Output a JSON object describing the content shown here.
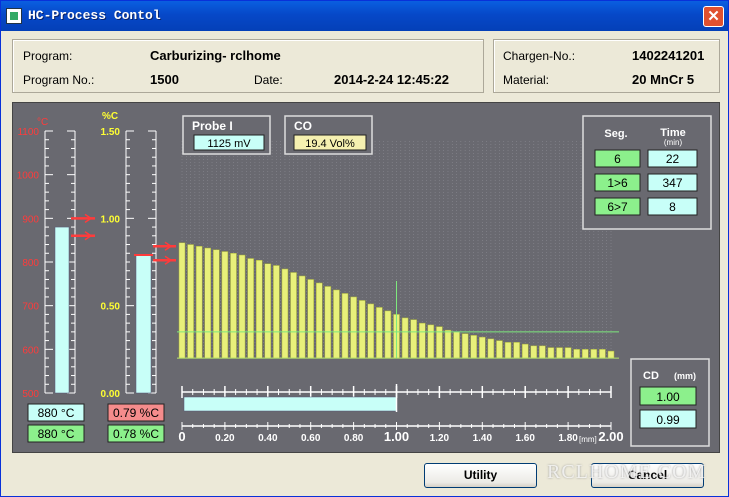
{
  "window": {
    "title": "HC-Process Contol",
    "close_glyph": "✕"
  },
  "program_info": {
    "program_label": "Program:",
    "program_value": "Carburizing- rclhome",
    "program_no_label": "Program No.:",
    "program_no_value": "1500",
    "date_label": "Date:",
    "date_value": "2014-2-24 12:45:22"
  },
  "charge_info": {
    "chargen_label": "Chargen-No.:",
    "chargen_value": "1402241201",
    "material_label": "Material:",
    "material_value": "20 MnCr 5"
  },
  "temp_gauge": {
    "unit": "°C",
    "ticks": [
      "1100",
      "1000",
      "900",
      "800",
      "700",
      "600",
      "500"
    ],
    "range": [
      500,
      1100
    ],
    "actual": 880,
    "setpoint_upper": 900,
    "setpoint_lower": 860,
    "readout_actual": "880 °C",
    "readout_setpoint": "880 °C"
  },
  "carbon_gauge": {
    "unit": "%C",
    "ticks": [
      "1.50",
      "1.00",
      "0.50",
      "0.00"
    ],
    "range": [
      0,
      1.5
    ],
    "actual": 0.79,
    "setpoint_upper": 0.84,
    "setpoint_lower": 0.76,
    "readout_actual": "0.79 %C",
    "readout_setpoint": "0.78 %C"
  },
  "probe": {
    "label": "Probe I",
    "value": "1125 mV"
  },
  "co": {
    "label": "CO",
    "value": "19.4 Vol%"
  },
  "segments": {
    "seg_header": "Seg.",
    "time_header": "Time",
    "time_unit": "(min)",
    "rows": [
      {
        "seg": "6",
        "time": "22"
      },
      {
        "seg": "1>6",
        "time": "347"
      },
      {
        "seg": "6>7",
        "time": "8"
      }
    ]
  },
  "cd": {
    "label": "CD",
    "unit": "(mm)",
    "value_actual": "1.00",
    "value_target": "0.99"
  },
  "chart_data": {
    "type": "bar",
    "title": "",
    "xlabel": "[mm]",
    "ylabel": "%C",
    "xlim": [
      0,
      2.0
    ],
    "ylim": [
      0,
      1.5
    ],
    "x_ticks": [
      "0",
      "0.20",
      "0.40",
      "0.60",
      "0.80",
      "1.00",
      "1.20",
      "1.40",
      "1.60",
      "1.80",
      "2.00"
    ],
    "cd_marker": 1.0,
    "cd_threshold": 0.35,
    "depth": [
      0.0,
      0.04,
      0.08,
      0.12,
      0.16,
      0.2,
      0.24,
      0.28,
      0.32,
      0.36,
      0.4,
      0.44,
      0.48,
      0.52,
      0.56,
      0.6,
      0.64,
      0.68,
      0.72,
      0.76,
      0.8,
      0.84,
      0.88,
      0.92,
      0.96,
      1.0,
      1.04,
      1.08,
      1.12,
      1.16,
      1.2,
      1.24,
      1.28,
      1.32,
      1.36,
      1.4,
      1.44,
      1.48,
      1.52,
      1.56,
      1.6,
      1.64,
      1.68,
      1.72,
      1.76,
      1.8,
      1.84,
      1.88,
      1.92,
      1.96,
      2.0
    ],
    "values": [
      0.86,
      0.85,
      0.84,
      0.83,
      0.82,
      0.81,
      0.8,
      0.79,
      0.77,
      0.76,
      0.74,
      0.73,
      0.71,
      0.69,
      0.67,
      0.65,
      0.63,
      0.61,
      0.59,
      0.57,
      0.55,
      0.53,
      0.51,
      0.49,
      0.47,
      0.45,
      0.43,
      0.42,
      0.4,
      0.39,
      0.38,
      0.36,
      0.35,
      0.34,
      0.33,
      0.32,
      0.31,
      0.3,
      0.29,
      0.29,
      0.28,
      0.27,
      0.27,
      0.26,
      0.26,
      0.26,
      0.25,
      0.25,
      0.25,
      0.25,
      0.24
    ],
    "base": 0.2,
    "colors": {
      "bar": "#e8f07a",
      "bar_edge": "#a4ad3a",
      "depth_fill": "#c8fff8"
    }
  },
  "buttons": {
    "utility": "Utility",
    "cancel": "Cancel"
  },
  "watermark": "RCLHOME.COM",
  "colors": {
    "panel": "#696970",
    "red": "#ff3b3b",
    "yellow": "#ffff33",
    "gauge_fill": "#c8fff8",
    "green_cell": "#8cf08c",
    "cyan_cell": "#c8fff8",
    "pink_cell": "#f58c8c"
  }
}
